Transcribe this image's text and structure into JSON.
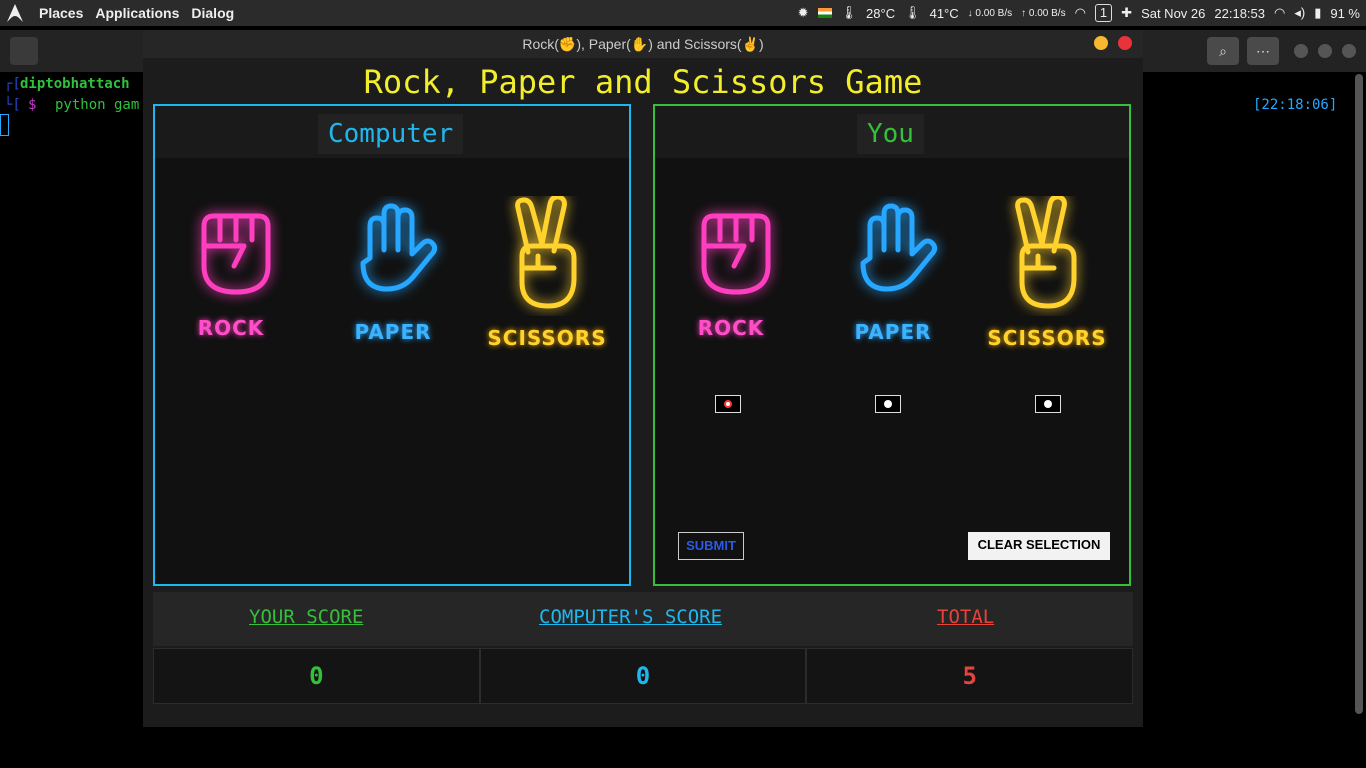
{
  "topbar": {
    "menu": [
      "Places",
      "Applications",
      "Dialog"
    ],
    "temp1": "28°C",
    "temp2": "41°C",
    "net_down": "↓ 0.00 B/s",
    "net_up": "↑ 0.00 B/s",
    "workspace": "1",
    "date": "Sat Nov 26",
    "time": "22:18:53",
    "battery": "91 %"
  },
  "terminal": {
    "user": "diptobhattach",
    "prompt": "$",
    "command": "python gam",
    "clock": "[22:18:06]"
  },
  "window": {
    "title": "Rock(✊), Paper(✋) and Scissors(✌)"
  },
  "game": {
    "title": "Rock, Paper and Scissors Game",
    "computer_title": "Computer",
    "you_title": "You",
    "choices": [
      "ROCK",
      "PAPER",
      "SCISSORS"
    ],
    "submit_label": "SUBMIT",
    "clear_label": "CLEAR SELECTION"
  },
  "scores": {
    "your_label": "YOUR SCORE",
    "computer_label": "COMPUTER'S SCORE",
    "total_label": "TOTAL",
    "your_value": "0",
    "computer_value": "0",
    "total_value": "5"
  },
  "colors": {
    "rock": "#ff3fbf",
    "paper": "#27a7ff",
    "scissors": "#ffd22e",
    "computer_border": "#1fb8ee",
    "you_border": "#34c038",
    "title": "#f2ee2b",
    "your_score": "#34c038",
    "computer_score": "#1fb8ee",
    "total": "#e8433a"
  }
}
